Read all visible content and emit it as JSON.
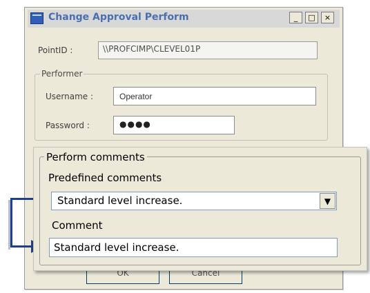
{
  "window": {
    "title": "Change Approval Perform",
    "minimize_glyph": "_",
    "maximize_glyph": "□",
    "close_glyph": "×"
  },
  "point": {
    "label": "PointID :",
    "value": "\\\\PROFCIMP\\CLEVEL01P"
  },
  "performer": {
    "legend": "Performer",
    "username_label": "Username :",
    "username_value": "Operator",
    "password_label": "Password :",
    "password_value": "●●●●"
  },
  "buttons": {
    "ok": "OK",
    "cancel": "Cancel"
  },
  "comments": {
    "legend": "Perform comments",
    "predefined_label": "Predefined comments",
    "predefined_value": "Standard level increase.",
    "dropdown_glyph": "▼",
    "comment_label": "Comment",
    "comment_value": "Standard level increase."
  },
  "colors": {
    "dialog_bg": "#ece9d8",
    "title_text": "#4a6fb1",
    "arrow": "#1f3f86"
  },
  "icons": {
    "app": "application-window-icon",
    "arrow": "copy-flow-arrow-icon"
  }
}
